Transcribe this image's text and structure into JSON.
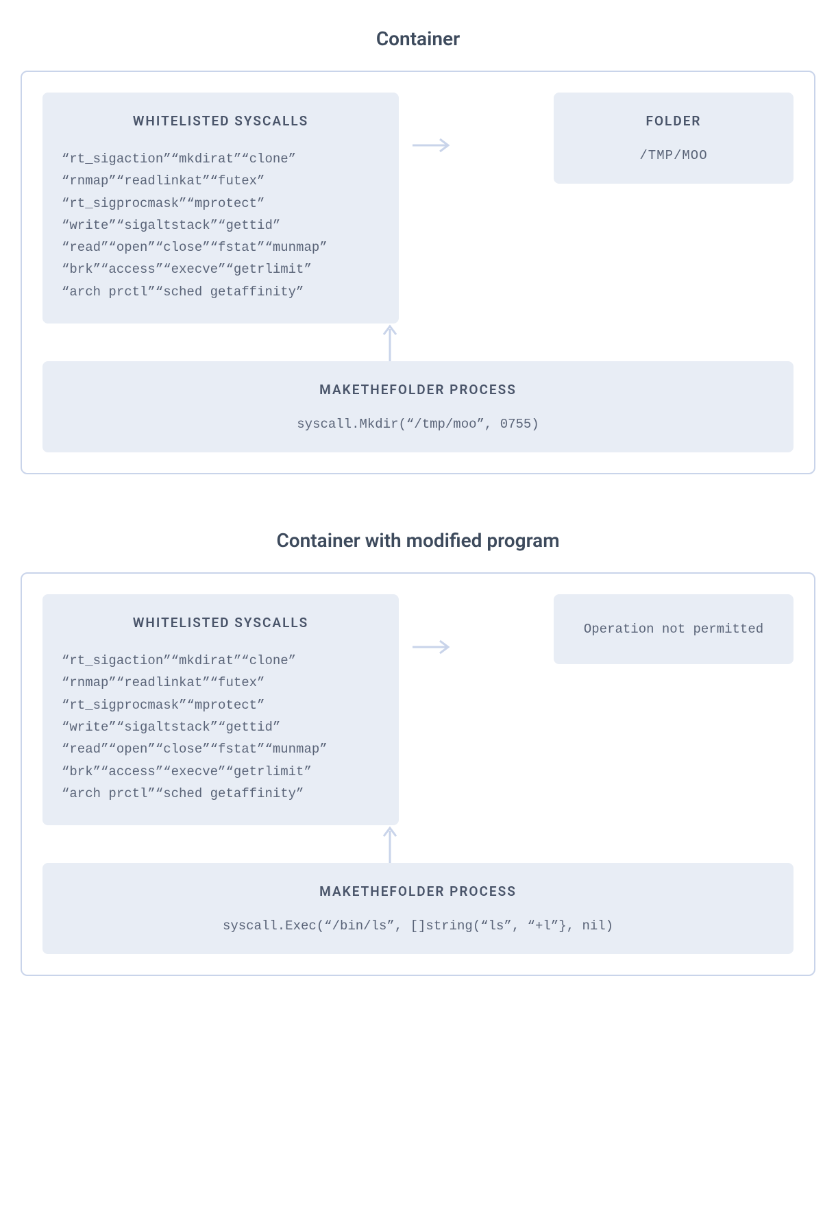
{
  "diagrams": [
    {
      "title": "Container",
      "syscalls": {
        "header": "WHITELISTED SYSCALLS",
        "lines": [
          "“rt_sigaction”“mkdirat”“clone”",
          "“rnmap”“readlinkat”“futex”",
          "“rt_sigprocmask”“mprotect”",
          "“write”“sigaltstack”“gettid”",
          "“read”“open”“close”“fstat”“munmap”",
          "“brk”“access”“execve”“getrlimit”",
          "“arch prctl”“sched getaffinity”"
        ]
      },
      "result": {
        "header": "FOLDER",
        "body": "/TMP/MOO",
        "hasHeader": true
      },
      "process": {
        "header": "MAKETHEFOLDER PROCESS",
        "body": "syscall.Mkdir(“/tmp/moo”, 0755)"
      }
    },
    {
      "title": "Container with modified program",
      "syscalls": {
        "header": "WHITELISTED SYSCALLS",
        "lines": [
          "“rt_sigaction”“mkdirat”“clone”",
          "“rnmap”“readlinkat”“futex”",
          "“rt_sigprocmask”“mprotect”",
          "“write”“sigaltstack”“gettid”",
          "“read”“open”“close”“fstat”“munmap”",
          "“brk”“access”“execve”“getrlimit”",
          "“arch prctl”“sched getaffinity”"
        ]
      },
      "result": {
        "header": "",
        "body": "Operation not permitted",
        "hasHeader": false
      },
      "process": {
        "header": "MAKETHEFOLDER PROCESS",
        "body": "syscall.Exec(“/bin/ls”, []string(“ls”, “+l”}, nil)"
      }
    }
  ]
}
